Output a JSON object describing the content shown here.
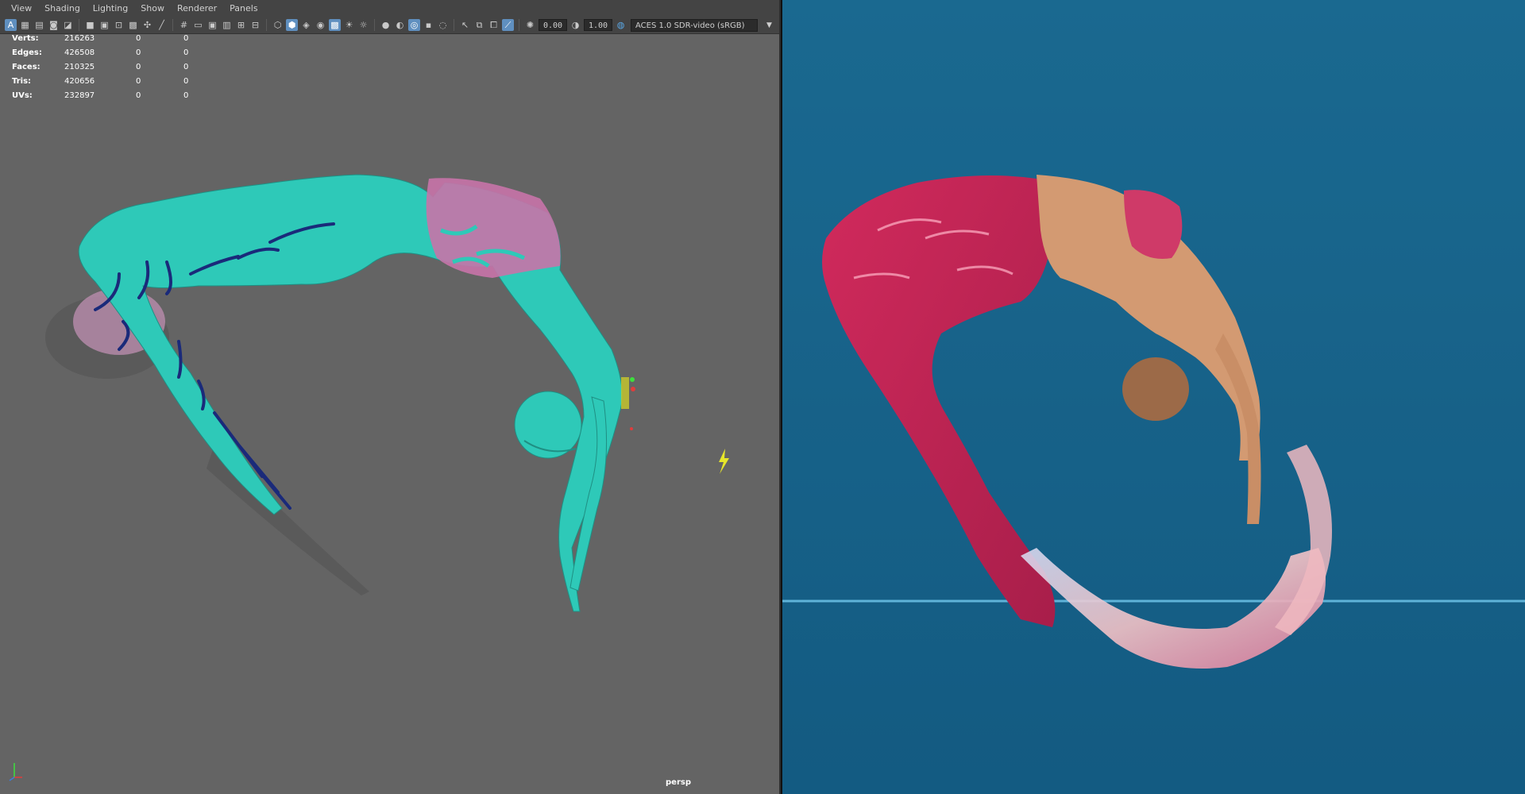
{
  "viewport": {
    "menu": [
      "View",
      "Shading",
      "Lighting",
      "Show",
      "Renderer",
      "Panels"
    ],
    "toolbar": {
      "exposure": "0.00",
      "gamma": "1.00",
      "color_space": "ACES 1.0 SDR-video (sRGB)"
    },
    "hud": [
      {
        "label": "Verts:",
        "v1": "216263",
        "v2": "0",
        "v3": "0"
      },
      {
        "label": "Edges:",
        "v1": "426508",
        "v2": "0",
        "v3": "0"
      },
      {
        "label": "Faces:",
        "v1": "210325",
        "v2": "0",
        "v3": "0"
      },
      {
        "label": "Tris:",
        "v1": "420656",
        "v2": "0",
        "v3": "0"
      },
      {
        "label": "UVs:",
        "v1": "232897",
        "v2": "0",
        "v3": "0"
      }
    ],
    "camera": "persp",
    "colors": {
      "background": "#646464",
      "model": "#2ec9b8",
      "cloth": "#c873a8",
      "fin_lines": "#1a2a7a"
    }
  },
  "reference": {
    "colors": {
      "water": "#1b6f9a",
      "tail": "#c8285a",
      "skin": "#d9a27a"
    }
  }
}
